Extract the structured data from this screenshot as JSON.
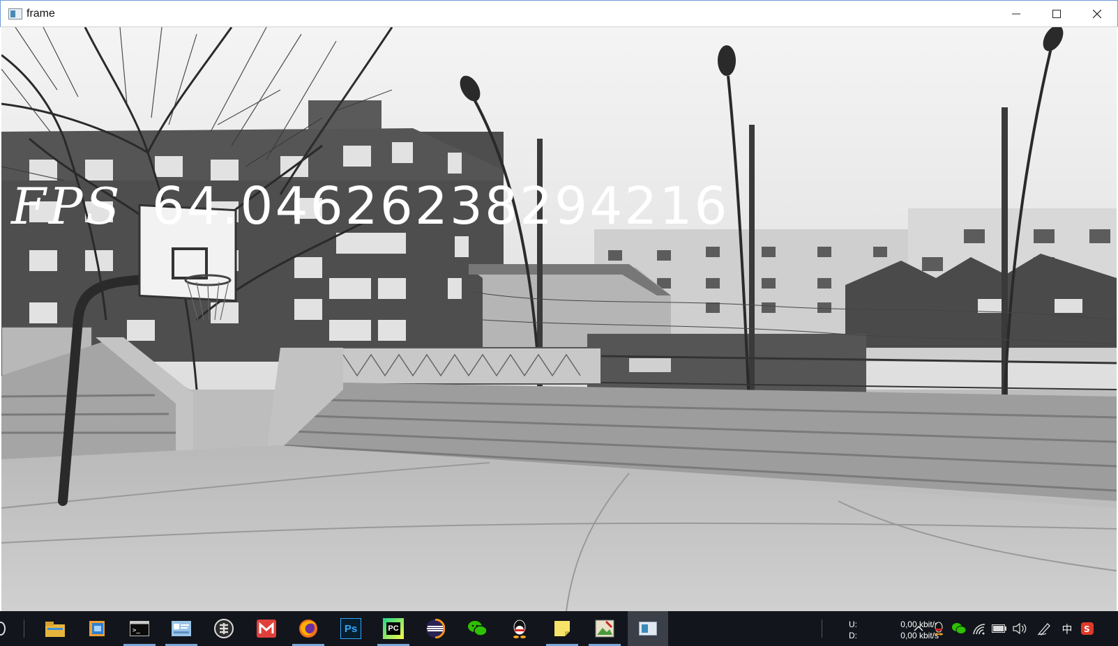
{
  "window": {
    "title": "frame"
  },
  "overlay": {
    "fps_label": "FPS",
    "fps_value": "64.04626238294216"
  },
  "taskbar": {
    "apps": [
      {
        "name": "file-explorer-icon",
        "state": "normal"
      },
      {
        "name": "notebook-app-icon",
        "state": "normal"
      },
      {
        "name": "terminal-icon",
        "state": "running"
      },
      {
        "name": "control-panel-icon",
        "state": "running"
      },
      {
        "name": "puzzle-app-icon",
        "state": "normal"
      },
      {
        "name": "mail-app-icon",
        "state": "normal"
      },
      {
        "name": "firefox-icon",
        "state": "running"
      },
      {
        "name": "photoshop-icon",
        "state": "normal",
        "text": "Ps"
      },
      {
        "name": "pycharm-icon",
        "state": "running",
        "text": "PC"
      },
      {
        "name": "eclipse-icon",
        "state": "normal"
      },
      {
        "name": "wechat-icon",
        "state": "normal"
      },
      {
        "name": "qq-icon",
        "state": "normal"
      },
      {
        "name": "sticky-notes-icon",
        "state": "running"
      },
      {
        "name": "image-viewer-icon",
        "state": "running"
      },
      {
        "name": "frame-window-icon",
        "state": "active"
      }
    ],
    "network": {
      "upload_label": "U:",
      "download_label": "D:",
      "upload_value": "0,00 kbit/s",
      "download_value": "0,00 kbit/s"
    },
    "tray": {
      "input_method": "中"
    }
  },
  "colors": {
    "taskbar_bg": "#12151b",
    "title_border": "#6b9bd8",
    "overlay_text": "#ffffff"
  }
}
